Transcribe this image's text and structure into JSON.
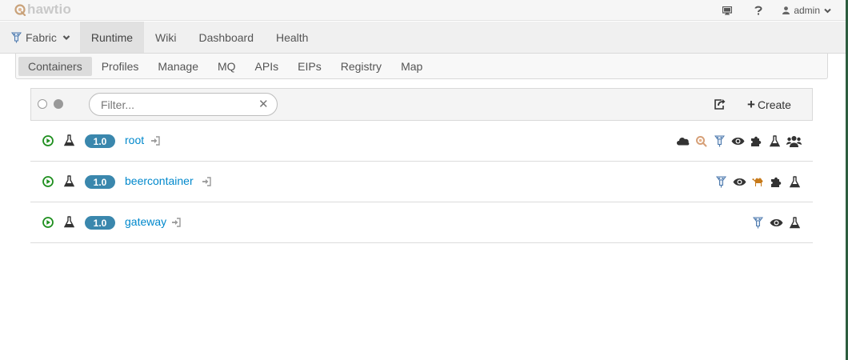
{
  "brand": {
    "name": "hawtio"
  },
  "topbar": {
    "user": "admin",
    "icons": [
      "monitor-icon",
      "question-icon",
      "user-icon",
      "chevron-down-icon"
    ]
  },
  "mainnav": {
    "items": [
      {
        "label": "Fabric",
        "icon": "fabric-icon",
        "has_dropdown": true
      },
      {
        "label": "Runtime",
        "active": true
      },
      {
        "label": "Wiki"
      },
      {
        "label": "Dashboard"
      },
      {
        "label": "Health"
      }
    ]
  },
  "subnav": {
    "items": [
      {
        "label": "Containers",
        "active": true
      },
      {
        "label": "Profiles"
      },
      {
        "label": "Manage"
      },
      {
        "label": "MQ"
      },
      {
        "label": "APIs"
      },
      {
        "label": "EIPs"
      },
      {
        "label": "Registry"
      },
      {
        "label": "Map"
      }
    ]
  },
  "toolbar": {
    "filter_placeholder": "Filter...",
    "filter_value": "",
    "create_label": "Create",
    "icons": [
      "select-none-icon",
      "select-all-icon",
      "clear-filter-icon",
      "export-icon",
      "plus-icon"
    ]
  },
  "containers": [
    {
      "version": "1.0",
      "name": "root",
      "status": "running",
      "icons": [
        "cloud-icon",
        "hawtio-icon",
        "fabric-icon",
        "eye-icon",
        "puzzle-icon",
        "flask-icon",
        "users-icon"
      ]
    },
    {
      "version": "1.0",
      "name": "beercontainer",
      "status": "running",
      "icons": [
        "fabric-icon",
        "eye-icon",
        "camel-icon",
        "puzzle-icon",
        "flask-icon"
      ]
    },
    {
      "version": "1.0",
      "name": "gateway",
      "status": "running",
      "icons": [
        "fabric-icon",
        "eye-icon",
        "flask-icon"
      ]
    }
  ],
  "colors": {
    "accent_badge": "#3a87ad",
    "link": "#0088cc",
    "running": "#1f8f1f",
    "camel": "#c77a1a"
  }
}
